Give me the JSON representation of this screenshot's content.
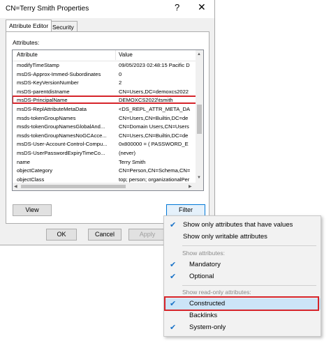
{
  "window": {
    "title": "CN=Terry Smith Properties",
    "help_glyph": "?",
    "close_glyph": "✕"
  },
  "tabs": [
    {
      "label": "Attribute Editor",
      "active": true
    },
    {
      "label": "Security",
      "active": false
    }
  ],
  "attributes_label": "Attributes:",
  "columns": {
    "attribute": "Attribute",
    "value": "Value"
  },
  "rows": [
    {
      "attribute": "modifyTimeStamp",
      "value": "09/05/2023 02:48:15 Pacific D"
    },
    {
      "attribute": "msDS-Approx-Immed-Subordinates",
      "value": "0"
    },
    {
      "attribute": "msDS-KeyVersionNumber",
      "value": "2"
    },
    {
      "attribute": "msDS-parentdistname",
      "value": "CN=Users,DC=demoxcs2022"
    },
    {
      "attribute": "msDS-PrincipalName",
      "value": "DEMOXCS2022\\tsmith",
      "highlighted": true
    },
    {
      "attribute": "msDS-ReplAttributeMetaData",
      "value": "<DS_REPL_ATTR_META_DA"
    },
    {
      "attribute": "msds-tokenGroupNames",
      "value": "CN=Users,CN=Builtin,DC=de"
    },
    {
      "attribute": "msds-tokenGroupNamesGlobalAnd...",
      "value": "CN=Domain Users,CN=Users"
    },
    {
      "attribute": "msds-tokenGroupNamesNoGCAcce...",
      "value": "CN=Users,CN=Builtin,DC=de"
    },
    {
      "attribute": "msDS-User-Account-Control-Compu...",
      "value": "0x800000 = ( PASSWORD_E"
    },
    {
      "attribute": "msDS-UserPasswordExpiryTimeCo...",
      "value": "(never)"
    },
    {
      "attribute": "name",
      "value": "Terry Smith"
    },
    {
      "attribute": "objectCategory",
      "value": "CN=Person,CN=Schema,CN="
    },
    {
      "attribute": "objectClass",
      "value": "top; person; organizationalPer"
    }
  ],
  "buttons": {
    "view": "View",
    "filter": "Filter",
    "ok": "OK",
    "cancel": "Cancel",
    "apply": "Apply"
  },
  "filter_menu": {
    "items": [
      {
        "label": "Show only attributes that have values",
        "checked": true
      },
      {
        "label": "Show only writable attributes",
        "checked": false
      }
    ],
    "show_attributes_header": "Show attributes:",
    "show_attributes": [
      {
        "label": "Mandatory",
        "checked": true
      },
      {
        "label": "Optional",
        "checked": true
      }
    ],
    "readonly_header": "Show read-only attributes:",
    "readonly": [
      {
        "label": "Constructed",
        "checked": true,
        "highlighted": true
      },
      {
        "label": "Backlinks",
        "checked": false
      },
      {
        "label": "System-only",
        "checked": true
      }
    ],
    "check_glyph": "✔"
  },
  "colors": {
    "highlight_border": "#d6242a",
    "menu_highlight": "#cce4f7",
    "check": "#1a73c8"
  }
}
